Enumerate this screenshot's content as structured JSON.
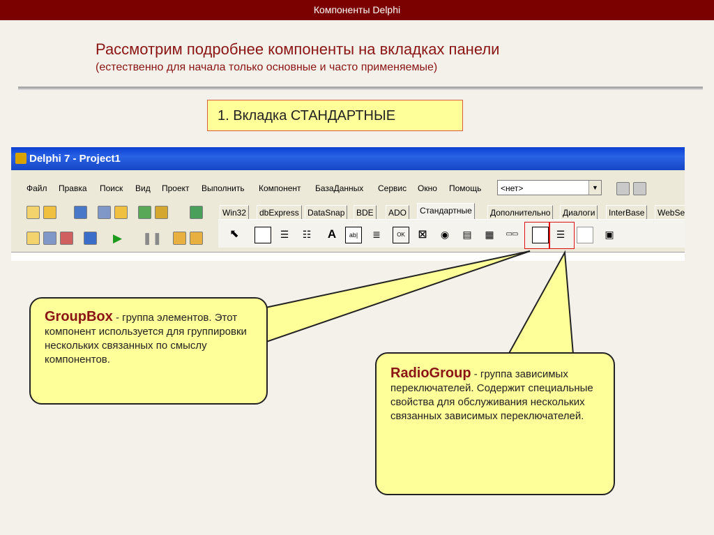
{
  "slide": {
    "top_title": "Компоненты Delphi",
    "heading": "Рассмотрим подробнее компоненты на вкладках панели",
    "subheading": "(естественно для начала только основные и часто применяемые)",
    "section_label": "1. Вкладка СТАНДАРТНЫЕ"
  },
  "delphi": {
    "window_title": "Delphi 7 - Project1",
    "menu": [
      "Файл",
      "Правка",
      "Поиск",
      "Вид",
      "Проект",
      "Выполнить",
      "Компонент",
      "БазаДанных",
      "Сервис",
      "Окно",
      "Помощь"
    ],
    "combo_value": "<нет>",
    "palette_tabs": [
      "Win32",
      "dbExpress",
      "DataSnap",
      "BDE",
      "ADO",
      "Стандартные",
      "Дополнительно",
      "Диалоги",
      "InterBase",
      "WebSe"
    ],
    "active_tab": "Стандартные"
  },
  "callouts": {
    "groupbox": {
      "name": "GroupBox",
      "text": " - группа элементов. Этот компонент используется для группировки нескольких связанных по смыслу компонентов."
    },
    "radiogroup": {
      "name": "RadioGroup",
      "text": " - группа зависимых переключателей. Содержит специальные свойства для обслуживания нескольких связанных зависимых переключателей."
    }
  },
  "colors": {
    "header_bg": "#7b0000",
    "accent_text": "#8b1414",
    "callout_fill": "#ffff99",
    "highlight_red": "#e01010"
  }
}
